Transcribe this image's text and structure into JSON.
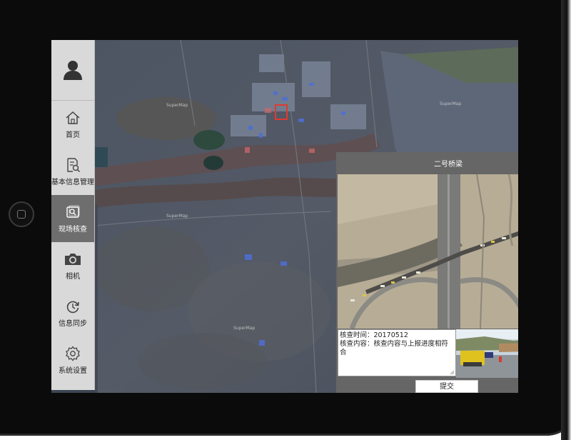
{
  "sidebar": {
    "items": [
      {
        "label": "首页",
        "icon": "home-icon"
      },
      {
        "label": "基本信息管理",
        "icon": "document-search-icon"
      },
      {
        "label": "现场核查",
        "icon": "photo-check-icon",
        "active": true
      },
      {
        "label": "相机",
        "icon": "camera-icon"
      },
      {
        "label": "信息同步",
        "icon": "sync-icon"
      },
      {
        "label": "系统设置",
        "icon": "gear-icon"
      }
    ],
    "active_color": "#6e6e6e",
    "background_color": "#d9d9d9"
  },
  "map": {
    "watermark": "SuperMap",
    "marker_color": "#e03a2f"
  },
  "popup": {
    "title": "二号桥梁",
    "info": {
      "time_label": "核查时间：",
      "time_value": "20170512",
      "content_label": "核查内容：",
      "content_value": "核查内容与上报进度相符合"
    },
    "submit_label": "提交"
  }
}
